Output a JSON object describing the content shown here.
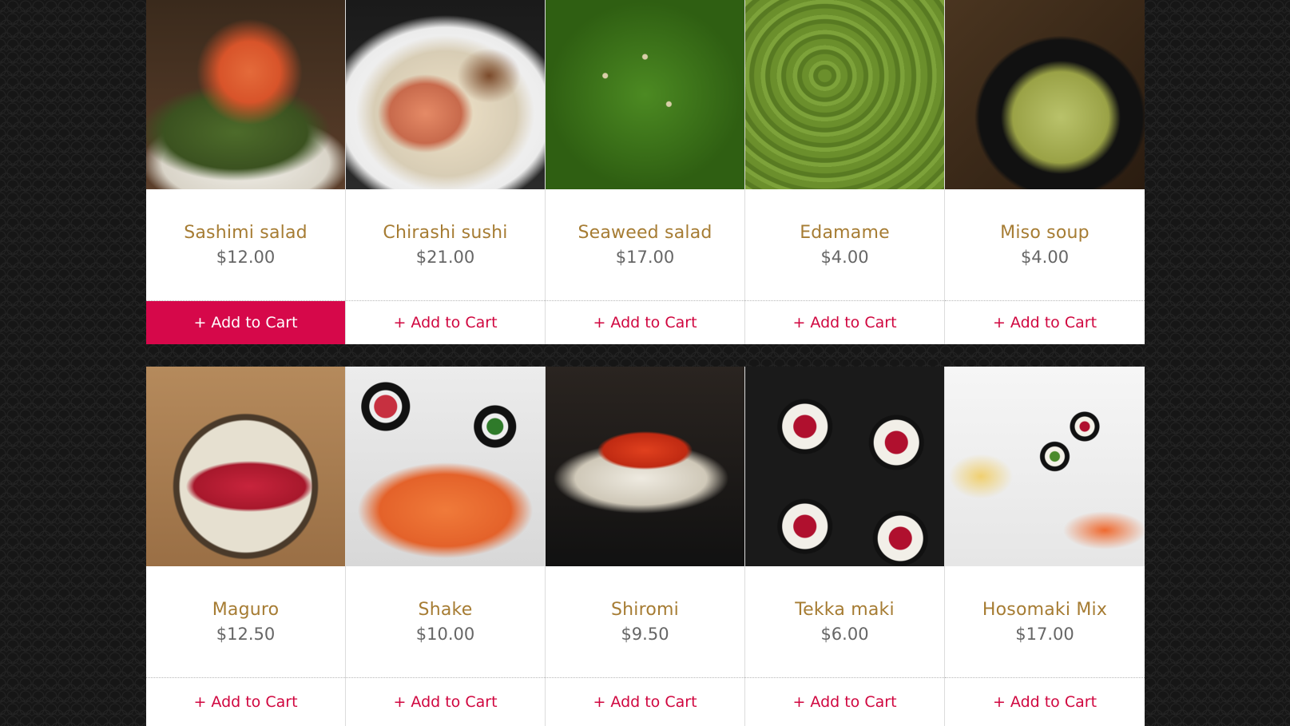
{
  "products": [
    {
      "name": "Sashimi salad",
      "price": "$12.00",
      "cart_label": "+ Add to Cart",
      "image_icon": "salad-photo"
    },
    {
      "name": "Chirashi sushi",
      "price": "$21.00",
      "cart_label": "+ Add to Cart",
      "image_icon": "chirashi-photo"
    },
    {
      "name": "Seaweed salad",
      "price": "$17.00",
      "cart_label": "+ Add to Cart",
      "image_icon": "seaweed-photo"
    },
    {
      "name": "Edamame",
      "price": "$4.00",
      "cart_label": "+ Add to Cart",
      "image_icon": "edamame-photo"
    },
    {
      "name": "Miso soup",
      "price": "$4.00",
      "cart_label": "+ Add to Cart",
      "image_icon": "miso-photo"
    },
    {
      "name": "Maguro",
      "price": "$12.50",
      "cart_label": "+ Add to Cart",
      "image_icon": "maguro-photo"
    },
    {
      "name": "Shake",
      "price": "$10.00",
      "cart_label": "+ Add to Cart",
      "image_icon": "shake-photo"
    },
    {
      "name": "Shiromi",
      "price": "$9.50",
      "cart_label": "+ Add to Cart",
      "image_icon": "shiromi-photo"
    },
    {
      "name": "Tekka maki",
      "price": "$6.00",
      "cart_label": "+ Add to Cart",
      "image_icon": "tekka-photo"
    },
    {
      "name": "Hosomaki Mix",
      "price": "$17.00",
      "cart_label": "+ Add to Cart",
      "image_icon": "hosomaki-photo"
    }
  ],
  "colors": {
    "name": "#a67c33",
    "price": "#666666",
    "cart_text": "#d0063f",
    "cart_active_bg": "#d6084a"
  }
}
